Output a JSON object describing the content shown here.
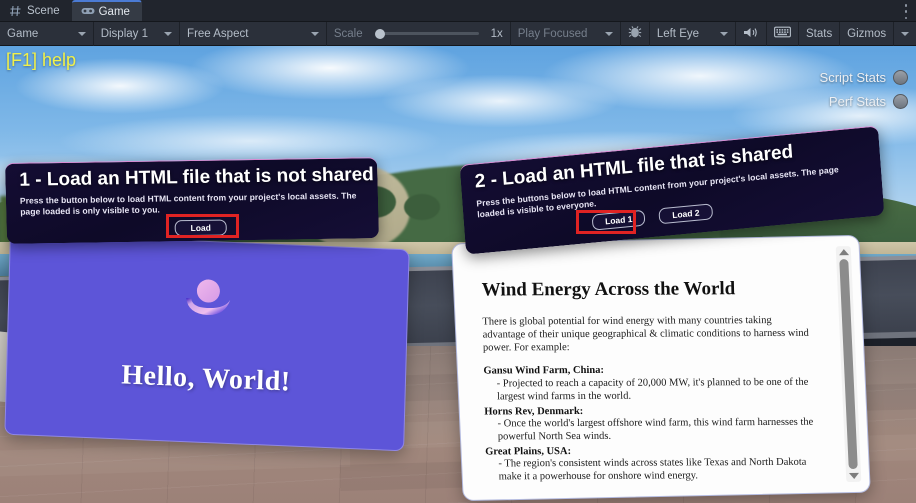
{
  "editor": {
    "tabs": [
      {
        "label": "Scene",
        "icon": "grid-icon",
        "active": false
      },
      {
        "label": "Game",
        "icon": "gamepad-icon",
        "active": true
      }
    ],
    "toolbar": {
      "target_display_group": "Game",
      "display": "Display 1",
      "aspect": "Free Aspect",
      "scale_label": "Scale",
      "scale_value": "1x",
      "play_mode": "Play Focused",
      "vr_debug_icon": "bug-icon",
      "eye": "Left Eye",
      "mute_icon": "speaker-icon",
      "keyboard_icon": "keyboard-icon",
      "stats": "Stats",
      "gizmos": "Gizmos",
      "overflow_icon": "kebab-menu-icon"
    }
  },
  "hud": {
    "help_hint": "[F1] help",
    "toggles": [
      {
        "label": "Script Stats"
      },
      {
        "label": "Perf Stats"
      }
    ]
  },
  "panels": [
    {
      "title": "1 - Load an HTML file that is not shared",
      "description": "Press the button below to load HTML content from your project's local assets. The page loaded is only visible to you.",
      "buttons": [
        {
          "label": "Load",
          "highlighted": true
        }
      ]
    },
    {
      "title": "2 - Load an HTML file that is shared",
      "description": "Press the buttons below to load HTML content from your project's local assets. The page loaded is visible to everyone.",
      "buttons": [
        {
          "label": "Load 1",
          "highlighted": true
        },
        {
          "label": "Load 2",
          "highlighted": false
        }
      ]
    }
  ],
  "purple_page": {
    "icon": "broken-image-icon",
    "heading": "Hello, World!",
    "background_color": "#5d55d8"
  },
  "document_page": {
    "heading": "Wind Energy Across the World",
    "intro": "There is global potential for wind energy with many countries taking advantage of their unique geographical & climatic conditions to harness wind power. For example:",
    "entries": [
      {
        "term": "Gansu Wind Farm, China:",
        "detail": "- Projected to reach a capacity of 20,000 MW, it's planned to be one of the largest wind farms in the world."
      },
      {
        "term": "Horns Rev, Denmark:",
        "detail": "- Once the world's largest offshore wind farm, this wind farm harnesses the powerful North Sea winds."
      },
      {
        "term": "Great Plains, USA:",
        "detail": "- The region's consistent winds across states like Texas and North Dakota make it a powerhouse for onshore wind energy."
      }
    ],
    "scrollbar": {
      "up_icon": "scroll-up-arrow-icon",
      "down_icon": "scroll-down-arrow-icon"
    }
  },
  "colors": {
    "accent_red_highlight": "#e02323",
    "panel_border_pink": "#d98ad2",
    "help_yellow": "#f1f14a",
    "editor_tab_active": "#4b7bd4"
  }
}
